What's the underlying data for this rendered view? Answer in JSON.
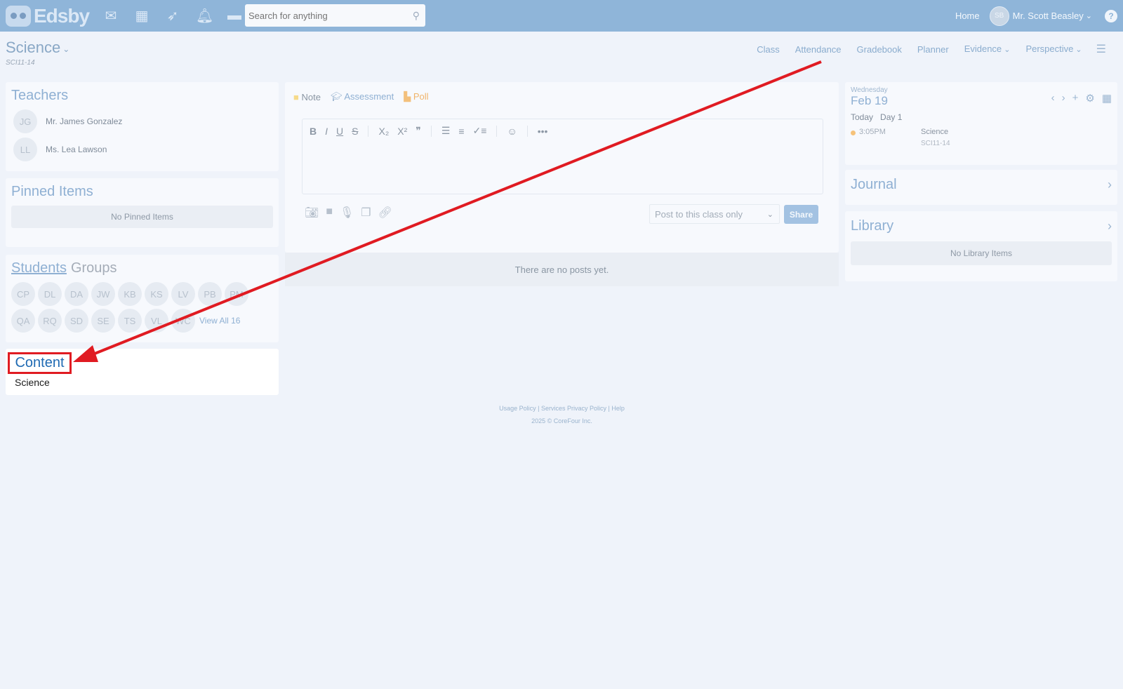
{
  "app": {
    "logo_text": "Edsby",
    "search_placeholder": "Search for anything",
    "home_label": "Home",
    "user_initials": "SB",
    "user_name": "Mr. Scott Beasley"
  },
  "class": {
    "title": "Science",
    "code": "SCI11-14",
    "nav": [
      "Class",
      "Attendance",
      "Gradebook",
      "Planner",
      "Evidence",
      "Perspective"
    ]
  },
  "teachers": {
    "title": "Teachers",
    "people": [
      {
        "initials": "JG",
        "name": "Mr. James Gonzalez"
      },
      {
        "initials": "LL",
        "name": "Ms. Lea Lawson"
      }
    ]
  },
  "pinned": {
    "title": "Pinned Items",
    "empty": "No Pinned Items"
  },
  "students": {
    "title": "Students",
    "groups_label": "Groups",
    "row1": [
      "CP",
      "DL",
      "DA",
      "JW",
      "KB",
      "KS",
      "LV",
      "PB",
      "PM"
    ],
    "row2": [
      "QA",
      "RQ",
      "SD",
      "SE",
      "TS",
      "VL",
      "WC"
    ],
    "view_all": "View All 16"
  },
  "content": {
    "title": "Content",
    "item": "Science"
  },
  "composer": {
    "tab_note": "Note",
    "tab_assessment": "Assessment",
    "tab_poll": "Poll",
    "post_option": "Post to this class only",
    "share_label": "Share"
  },
  "feed": {
    "empty": "There are no posts yet."
  },
  "calendar": {
    "weekday": "Wednesday",
    "date": "Feb 19",
    "today_label": "Today",
    "day_label": "Day 1",
    "event_time": "3:05PM",
    "event_title": "Science",
    "event_code": "SCI11-14"
  },
  "journal": {
    "title": "Journal"
  },
  "library": {
    "title": "Library",
    "empty": "No Library Items"
  },
  "footer": {
    "usage": "Usage Policy",
    "privacy": "Services Privacy Policy",
    "help": "Help",
    "copyright": "2025 © CoreFour Inc."
  },
  "colors": {
    "topbar": "#8fb5d9",
    "accent": "#8fb0d3",
    "highlight_box": "#e01b22",
    "content_title": "#1f6ab3"
  }
}
